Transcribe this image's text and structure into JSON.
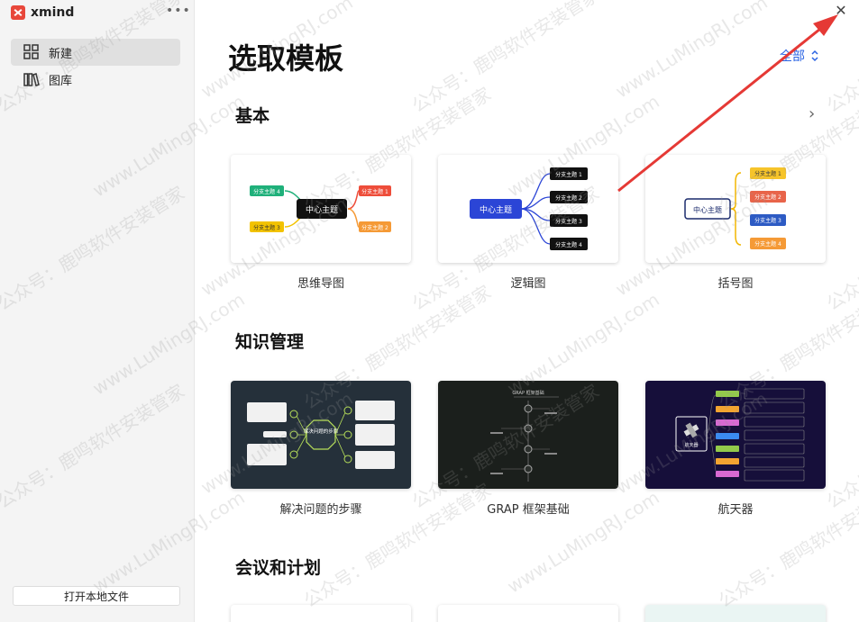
{
  "app": {
    "name": "xmind",
    "more": "•••"
  },
  "sidebar": {
    "items": [
      {
        "label": "新建",
        "icon": "grid-icon",
        "active": true
      },
      {
        "label": "图库",
        "icon": "library-icon",
        "active": false
      }
    ],
    "open_file": "打开本地文件"
  },
  "main": {
    "title": "选取模板",
    "filter_label": "全部",
    "close": "✕",
    "next": "›"
  },
  "sections": [
    {
      "title": "基本",
      "cards": [
        {
          "label": "思维导图",
          "center": "中心主题",
          "branches": [
            "分支主题 1",
            "分支主题 2",
            "分支主题 3",
            "分支主题 4"
          ]
        },
        {
          "label": "逻辑图",
          "center": "中心主题",
          "branches": [
            "分支主题 1",
            "分支主题 2",
            "分支主题 3",
            "分支主题 4"
          ]
        },
        {
          "label": "括号图",
          "center": "中心主题",
          "branches": [
            "分支主题 1",
            "分支主题 2",
            "分支主题 3",
            "分支主题 4"
          ]
        }
      ]
    },
    {
      "title": "知识管理",
      "cards": [
        {
          "label": "解决问题的步骤",
          "center": "解决问题的步骤"
        },
        {
          "label": "GRAP 框架基础",
          "center": "GRAP 框架基础"
        },
        {
          "label": "航天器",
          "center": "航天器"
        }
      ]
    },
    {
      "title": "会议和计划",
      "cards": []
    }
  ],
  "watermark": [
    "公众号：鹿鸣软件安装管家",
    "www.LuMingRJ.com"
  ],
  "colors": {
    "accent": "#2a63e3",
    "annotation": "#e53935",
    "brand": "#e8473a"
  }
}
